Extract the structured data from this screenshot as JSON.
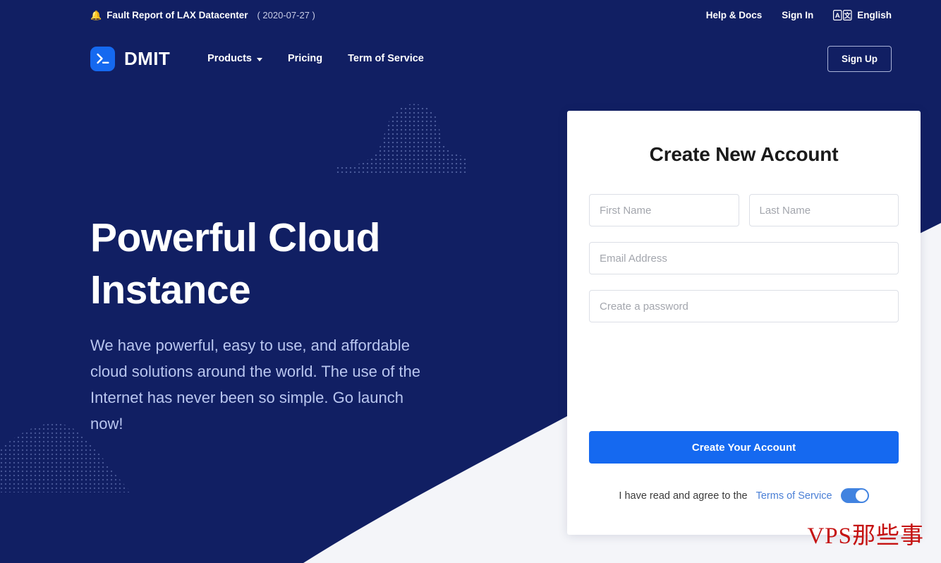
{
  "colors": {
    "navy": "#111f63",
    "accent_blue": "#1569f0",
    "hero_subtitle": "#b9c6ef",
    "card_white": "#ffffff",
    "page_bg": "#f4f5f9",
    "watermark_red": "#c51212",
    "toggle_on": "#4183e0"
  },
  "topbar": {
    "notice_icon": "bell-icon",
    "notice_label": "Fault Report of LAX Datacenter",
    "notice_date": "( 2020-07-27 )",
    "help_label": "Help & Docs",
    "signin_label": "Sign In",
    "language_icon": "translate-icon",
    "language_label": "English",
    "language_icon_glyphs": [
      "A",
      "文"
    ]
  },
  "nav": {
    "logo_icon": "terminal-prompt-icon",
    "brand": "DMIT",
    "links": [
      {
        "label": "Products",
        "has_caret": true,
        "icon": "chevron-down-icon"
      },
      {
        "label": "Pricing",
        "has_caret": false
      },
      {
        "label": "Term of Service",
        "has_caret": false
      }
    ],
    "signup_label": "Sign Up"
  },
  "hero": {
    "title_line1": "Powerful Cloud",
    "title_line2": "Instance",
    "subtitle": "We have powerful, easy to use, and affordable cloud solutions around the world. The use of the Internet has never been so simple. Go launch now!"
  },
  "signup_form": {
    "title": "Create New Account",
    "first_name_placeholder": "First Name",
    "first_name_value": "",
    "last_name_placeholder": "Last Name",
    "last_name_value": "",
    "email_placeholder": "Email Address",
    "email_value": "",
    "password_placeholder": "Create a password",
    "password_value": "",
    "submit_label": "Create Your Account",
    "terms_text": "I have read and agree to the",
    "terms_link_label": "Terms of Service",
    "terms_toggle_state": "on"
  },
  "watermark": {
    "text": "VPS那些事"
  }
}
